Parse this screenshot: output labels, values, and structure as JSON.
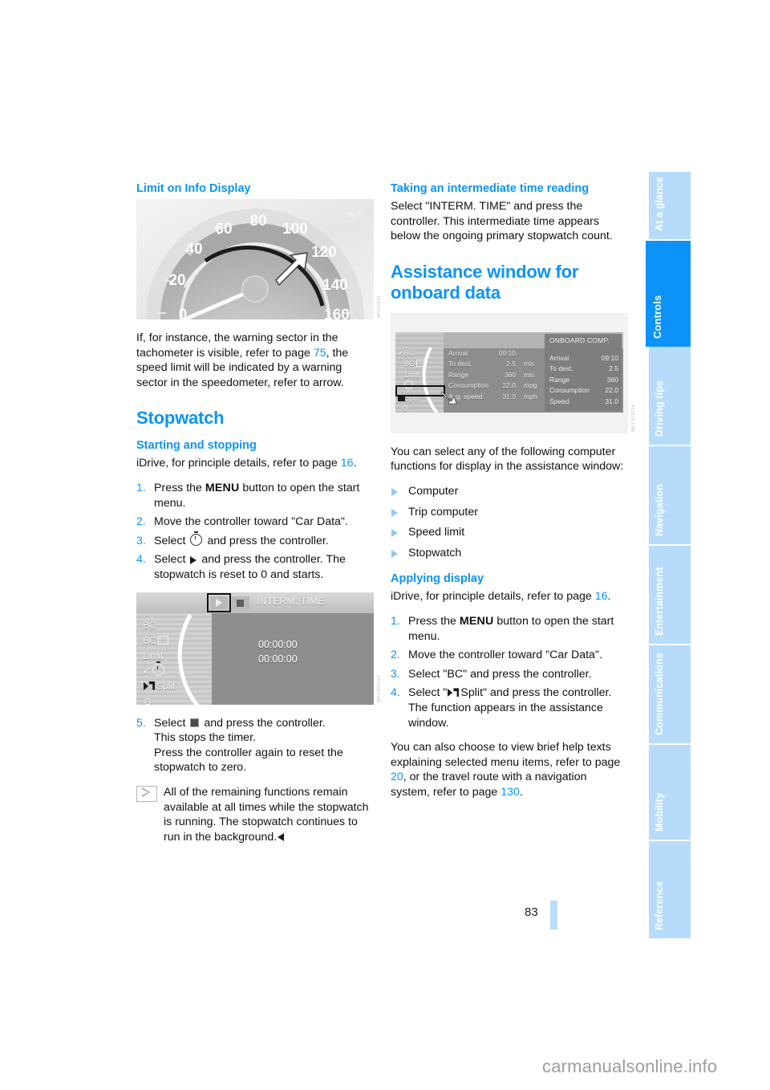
{
  "document": {
    "page_number": "83",
    "watermark": "carmanualsonline.info"
  },
  "sidebar": {
    "tabs": [
      {
        "label": "At a glance",
        "active": false
      },
      {
        "label": "Controls",
        "active": true
      },
      {
        "label": "Driving tips",
        "active": false
      },
      {
        "label": "Navigation",
        "active": false
      },
      {
        "label": "Entertainment",
        "active": false
      },
      {
        "label": "Communications",
        "active": false
      },
      {
        "label": "Mobility",
        "active": false
      },
      {
        "label": "Reference",
        "active": false
      }
    ],
    "colors": {
      "active_bg": "#0d93f7",
      "inactive_bg": "#b7dcfb",
      "label": "#ffffff"
    }
  },
  "left_column": {
    "heading_limit": "Limit on Info Display",
    "figure_speedometer": {
      "name": "speedometer-warning-sector",
      "tick_labels": [
        "0",
        "20",
        "40",
        "60",
        "80",
        "100",
        "120",
        "140",
        "160"
      ],
      "corner_label": "mph",
      "code": "MPH3810"
    },
    "paragraph_limit": "If, for instance, the warning sector in the tachometer is visible, refer to page 75, the speed limit will be indicated by a warning sector in the speedometer, refer to arrow.",
    "paragraph_limit_parts": {
      "before": "If, for instance, the warning sector in the tachometer is visible, refer to page ",
      "pageref": "75",
      "after": ", the speed limit will be indicated by a warning sector in the speedometer, refer to arrow."
    },
    "heading_stopwatch": "Stopwatch",
    "heading_starting": "Starting and stopping",
    "idrive_line": {
      "before": "iDrive, for principle details, refer to page ",
      "pageref": "16",
      "after": "."
    },
    "steps": [
      {
        "n": "1.",
        "parts": [
          "Press the ",
          "MENU",
          " button to open the start menu."
        ]
      },
      {
        "n": "2.",
        "parts": [
          "Move the controller toward \"Car Data\"."
        ]
      },
      {
        "n": "3.",
        "parts": [
          "Select ",
          "stopwatch-icon",
          " and press the controller."
        ]
      },
      {
        "n": "4.",
        "parts": [
          "Select ",
          "play-icon",
          " and press the controller. The stopwatch is reset to 0 and starts."
        ]
      }
    ],
    "step1_a": "Press the ",
    "step1_menu": "MENU",
    "step1_b": " button to open the start menu.",
    "step2": "Move the controller toward \"Car Data\".",
    "step3_a": "Select ",
    "step3_b": " and press the controller.",
    "step4_a": "Select ",
    "step4_b": " and press the controller. The stopwatch is reset to 0 and starts.",
    "figure_idrive": {
      "name": "idrive-stopwatch-screen",
      "header_label": "INTERM. TIME",
      "menu_items": [
        "BC",
        "BC",
        "Limit",
        "",
        "Split",
        ""
      ],
      "menu_item_1": "BC",
      "menu_item_2": "BC",
      "menu_item_3": "Limit",
      "menu_item_5": "Split",
      "time_primary": "00:00:00",
      "time_secondary": "00:00:00",
      "code": "MK1303123"
    },
    "step5_a": "Select ",
    "step5_b": " and press the controller.",
    "step5_c": "This stops the timer.",
    "step5_d": "Press the controller again to reset the stopwatch to zero.",
    "note": "All of the remaining functions remain available at all times while the stopwatch is running. The stopwatch continues to run in the background."
  },
  "right_column": {
    "heading_interm": "Taking an intermediate time reading",
    "paragraph_interm": "Select \"INTERM. TIME\" and press the controller. This intermediate time appears below the ongoing primary stopwatch count.",
    "heading_assistance_l1": "Assistance window for",
    "heading_assistance_l2": "onboard data",
    "figure_obc": {
      "name": "onboard-computer-assistance-window",
      "assistance_title": "ONBOARD COMP.",
      "menu_items": [
        "BC",
        "BC",
        "Limit",
        "",
        "Split",
        ""
      ],
      "menu_item_1": "BC",
      "menu_item_2": "BC",
      "menu_item_3": "Limit",
      "menu_item_5": "Split",
      "main_rows": [
        {
          "label": "Arrival",
          "value": "09:10",
          "unit": ""
        },
        {
          "label": "To dest.",
          "value": "2.5",
          "unit": "mls"
        },
        {
          "label": "Range",
          "value": "360",
          "unit": "mls"
        },
        {
          "label": "Consumption",
          "value": "22.0",
          "unit": "mpg"
        },
        {
          "label": "Avg. speed",
          "value": "31.0",
          "unit": "mph"
        }
      ],
      "assist_rows": [
        {
          "label": "Arrival",
          "value": "09:10"
        },
        {
          "label": "To dest.",
          "value": "2.5"
        },
        {
          "label": "Range",
          "value": "360"
        },
        {
          "label": "Consumption",
          "value": "22.0"
        },
        {
          "label": "Speed",
          "value": "31.0"
        }
      ],
      "code": "MK1303124"
    },
    "paragraph_select": "You can select any of the following computer functions for display in the assistance window:",
    "functions": [
      "Computer",
      "Trip computer",
      "Speed limit",
      "Stopwatch"
    ],
    "heading_applying": "Applying display",
    "idrive_line": {
      "before": "iDrive, for principle details, refer to page ",
      "pageref": "16",
      "after": "."
    },
    "step1_a": "Press the ",
    "step1_menu": "MENU",
    "step1_b": " button to open the start menu.",
    "step2": "Move the controller toward \"Car Data\".",
    "step3": "Select \"BC\" and press the controller.",
    "step4_a": "Select \"",
    "step4_b": "Split\" and press the controller. The function appears in the assistance window.",
    "closing": {
      "p1": "You can also choose to view brief help texts explaining selected menu items, refer to page ",
      "ref1": "20",
      "p2": ", or the travel route with a navigation system, refer to page ",
      "ref2": "130",
      "p3": "."
    }
  },
  "colors": {
    "accent_blue": "#0d93f7",
    "tab_light": "#b7dcfb",
    "folio_bar": "#bbdcfa",
    "body_text": "#111111"
  }
}
